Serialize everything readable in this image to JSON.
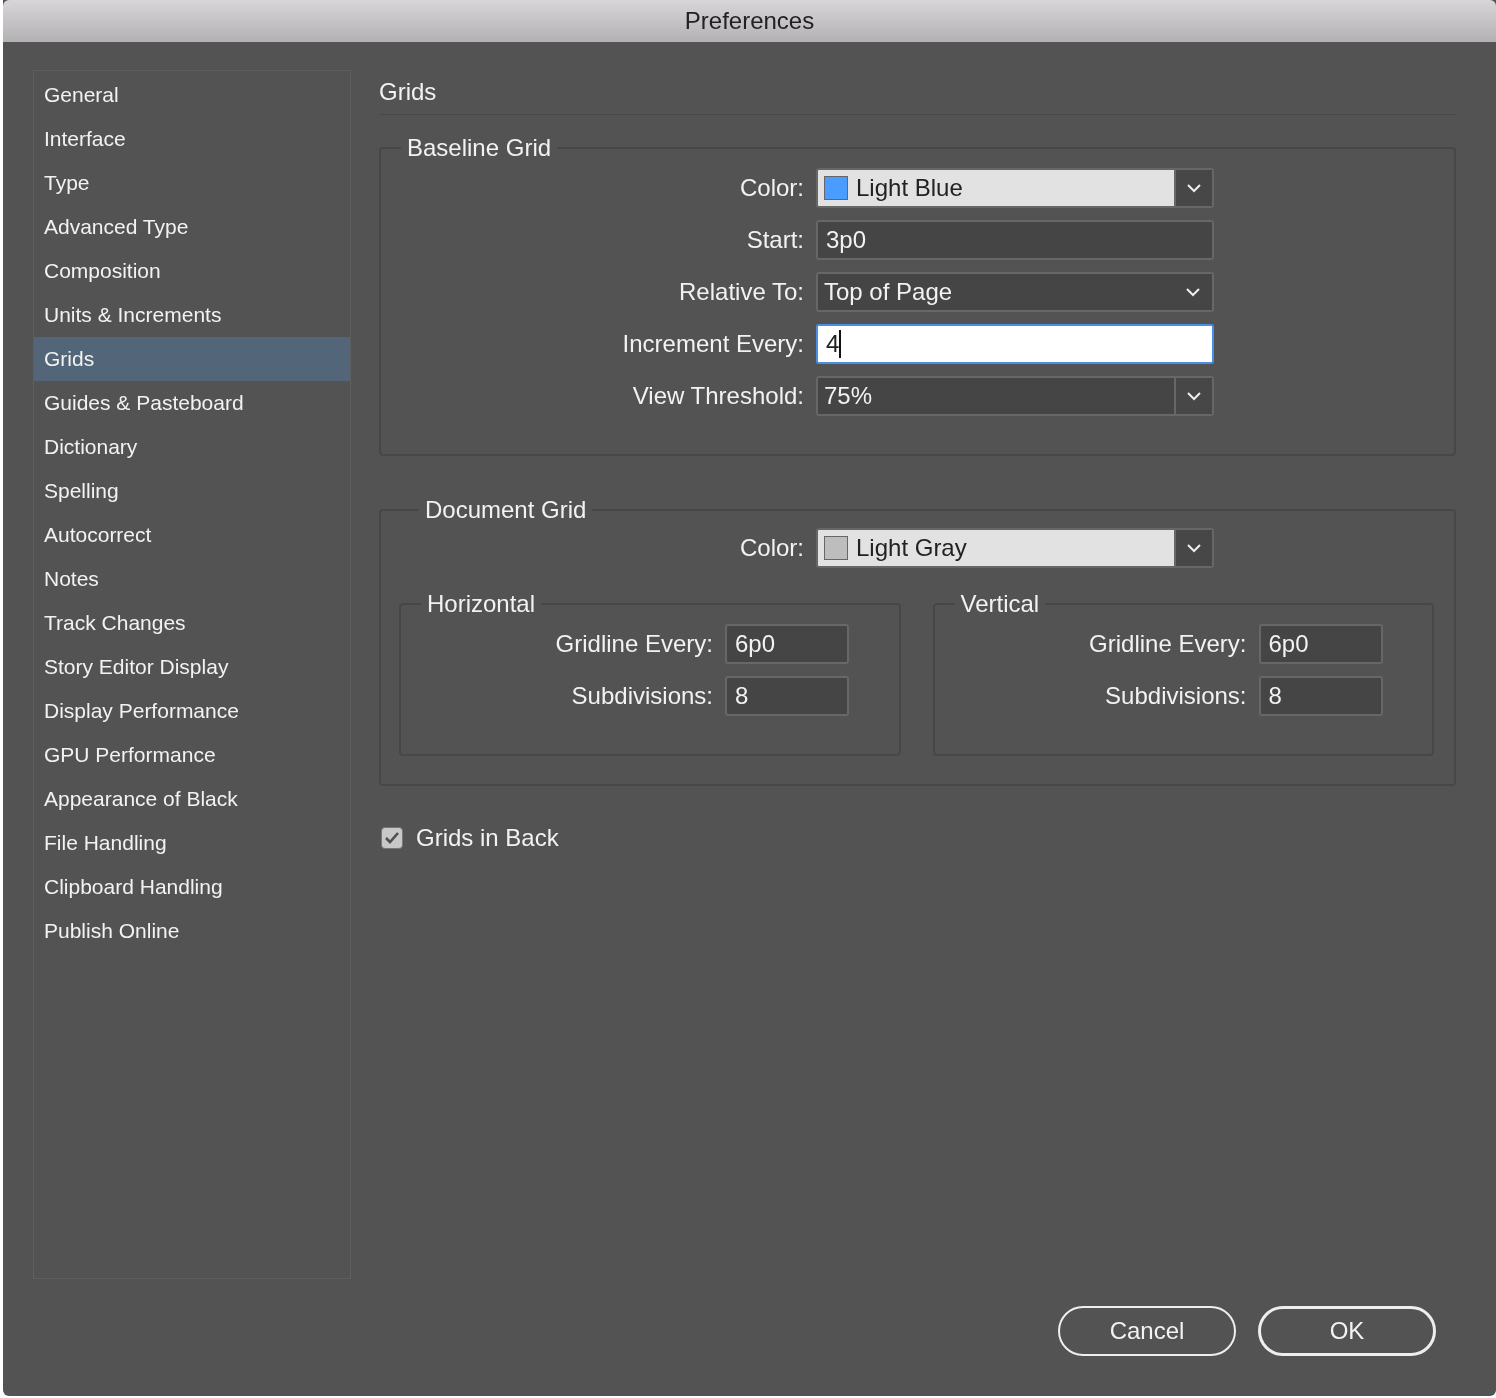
{
  "window": {
    "title": "Preferences"
  },
  "sidebar": {
    "items": [
      {
        "label": "General",
        "selected": false
      },
      {
        "label": "Interface",
        "selected": false
      },
      {
        "label": "Type",
        "selected": false
      },
      {
        "label": "Advanced Type",
        "selected": false
      },
      {
        "label": "Composition",
        "selected": false
      },
      {
        "label": "Units & Increments",
        "selected": false
      },
      {
        "label": "Grids",
        "selected": true
      },
      {
        "label": "Guides & Pasteboard",
        "selected": false
      },
      {
        "label": "Dictionary",
        "selected": false
      },
      {
        "label": "Spelling",
        "selected": false
      },
      {
        "label": "Autocorrect",
        "selected": false
      },
      {
        "label": "Notes",
        "selected": false
      },
      {
        "label": "Track Changes",
        "selected": false
      },
      {
        "label": "Story Editor Display",
        "selected": false
      },
      {
        "label": "Display Performance",
        "selected": false
      },
      {
        "label": "GPU Performance",
        "selected": false
      },
      {
        "label": "Appearance of Black",
        "selected": false
      },
      {
        "label": "File Handling",
        "selected": false
      },
      {
        "label": "Clipboard Handling",
        "selected": false
      },
      {
        "label": "Publish Online",
        "selected": false
      }
    ]
  },
  "panel": {
    "title": "Grids"
  },
  "baseline_grid": {
    "title": "Baseline Grid",
    "fields": [
      {
        "kind": "swatch_dropdown",
        "label": "Color:",
        "value": "Light Blue",
        "color": "#4a9cff"
      },
      {
        "kind": "text",
        "label": "Start:",
        "value": "3p0",
        "focused": false
      },
      {
        "kind": "dropdown",
        "label": "Relative To:",
        "value": "Top of Page"
      },
      {
        "kind": "text",
        "label": "Increment Every:",
        "value": "4",
        "focused": true
      },
      {
        "kind": "combo",
        "label": "View Threshold:",
        "value": "75%"
      }
    ]
  },
  "document_grid": {
    "title": "Document Grid",
    "color_field": {
      "kind": "swatch_dropdown",
      "label": "Color:",
      "value": "Light Gray",
      "color": "#bdbdbd"
    },
    "groups": [
      {
        "title": "Horizontal",
        "fields": [
          {
            "label": "Gridline Every:",
            "value": "6p0"
          },
          {
            "label": "Subdivisions:",
            "value": "8"
          }
        ]
      },
      {
        "title": "Vertical",
        "fields": [
          {
            "label": "Gridline Every:",
            "value": "6p0"
          },
          {
            "label": "Subdivisions:",
            "value": "8"
          }
        ]
      }
    ]
  },
  "grids_in_back": {
    "label": "Grids in Back",
    "checked": true
  },
  "buttons": [
    {
      "label": "Cancel",
      "default": false
    },
    {
      "label": "OK",
      "default": true
    }
  ]
}
